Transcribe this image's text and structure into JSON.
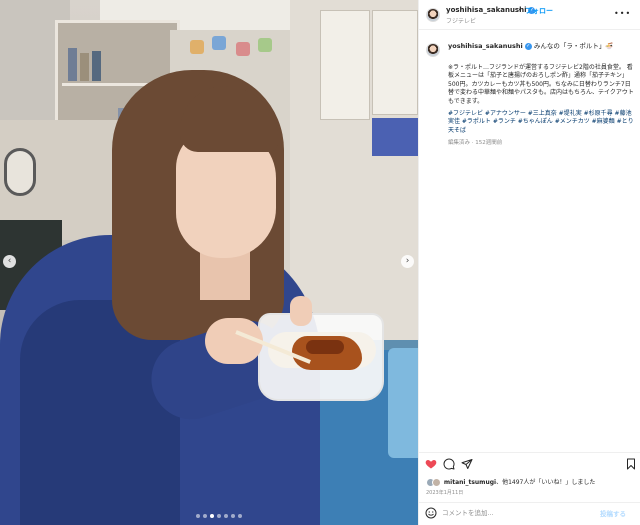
{
  "post": {
    "username": "yoshihisa_sakanushi",
    "separator": "•",
    "follow_label": "フォロー",
    "location": "フジテレビ",
    "more": "•••"
  },
  "caption": {
    "username": "yoshihisa_sakanushi",
    "headline": "みんなの「ラ・ポルト」🍜",
    "body": "※ラ・ポルト…フジランドが運営するフジテレビ2階の社員食堂。 看板メニューは「茄子と唐揚げのおろしポン酢」通称「茄子チキン」500円。カツカレーもカツ丼も500円。ちなみに日替わりランチ7日替で変わる中華麺や和麺やパスタも。店内はもちろん、テイクアウトもできます。",
    "hashtags": "#フジテレビ #アナウンサー #三上真奈 #堤礼実 #杉原千尋 #藤池実佳 #ラポルト #ランチ #ちゃんぽん #メンチカツ #麻婆麺 #とり天そば",
    "edited": "編集済み · 152週間前"
  },
  "likes": {
    "user": "mitani_tsumugi",
    "text_suffix": "、他1497人が「いいね！」しました"
  },
  "date": "2023年1月11日",
  "comment": {
    "placeholder": "コメントを追加...",
    "post_label": "投稿する"
  },
  "icons": {
    "like": "heart-icon-filled",
    "comment": "comment-icon",
    "share": "share-icon",
    "save": "bookmark-icon",
    "emoji": "emoji-icon"
  },
  "colors": {
    "link_blue": "#0095f6",
    "like_red": "#ed4956",
    "hashtag": "#00376b",
    "muted": "#8e8e8e"
  },
  "carousel": {
    "prev": "‹",
    "next": "›"
  }
}
